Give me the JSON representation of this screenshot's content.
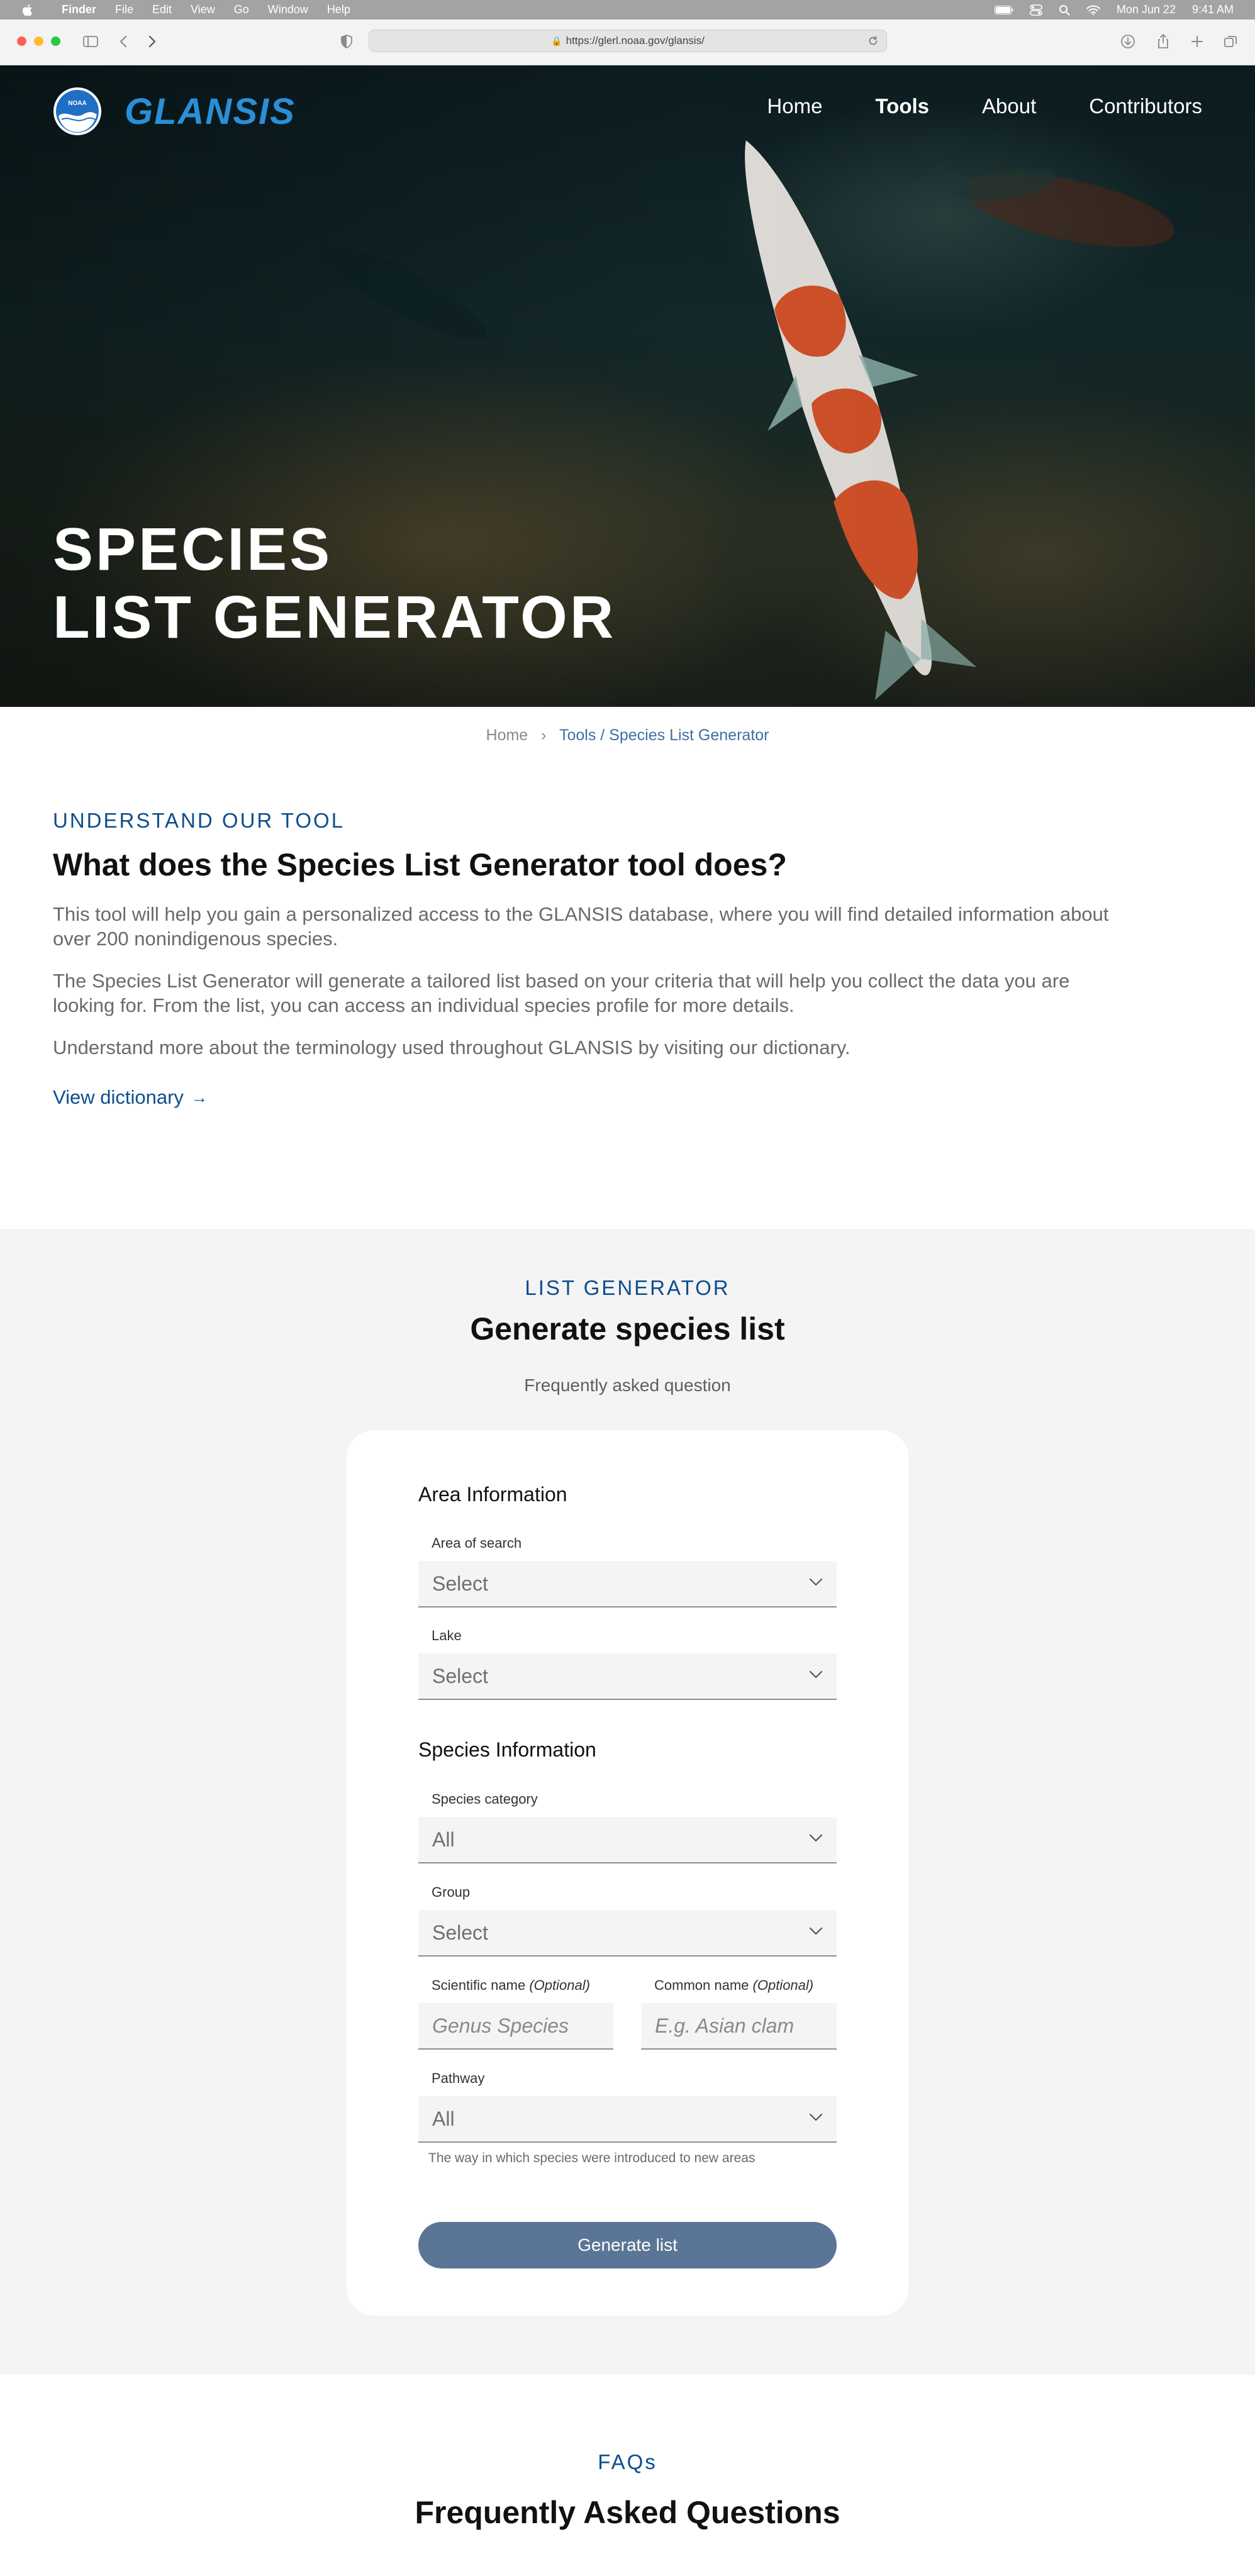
{
  "menubar": {
    "app_name": "Finder",
    "items": [
      "File",
      "Edit",
      "View",
      "Go",
      "Window",
      "Help"
    ],
    "date": "Mon Jun 22",
    "time": "9:41 AM"
  },
  "browser": {
    "url": "https://glerl.noaa.gov/glansis/"
  },
  "header": {
    "logo_badge_text": "NOAA",
    "logo_wordmark": "GLANSIS",
    "nav": [
      "Home",
      "Tools",
      "About",
      "Contributors"
    ],
    "active_nav": "Tools"
  },
  "hero": {
    "title_line1": "SPECIES",
    "title_line2": "LIST GENERATOR"
  },
  "breadcrumb": {
    "home": "Home",
    "current": "Tools / Species List Generator"
  },
  "understand": {
    "eyebrow": "UNDERSTAND OUR TOOL",
    "heading": "What does the Species List Generator tool does?",
    "p1": "This tool will help you gain a personalized access to the GLANSIS database, where you will find detailed information about over 200 nonindigenous species.",
    "p2": "The Species List Generator will generate a tailored list based on your criteria that will help you collect the data you are looking for. From the list, you can access an individual species profile for more details.",
    "p3": "Understand more about the terminology used throughout GLANSIS by visiting our dictionary.",
    "link": "View dictionary"
  },
  "generator": {
    "eyebrow": "LIST GENERATOR",
    "heading": "Generate species list",
    "subtext": "Frequently asked question",
    "area_title": "Area Information",
    "area_label": "Area of search",
    "area_value": "Select",
    "lake_label": "Lake",
    "lake_value": "Select",
    "species_title": "Species Information",
    "category_label": "Species category",
    "category_value": "All",
    "group_label": "Group",
    "group_value": "Select",
    "sci_label": "Scientific name",
    "sci_optional": "(Optional)",
    "sci_placeholder": "Genus Species",
    "common_label": "Common name",
    "common_optional": "(Optional)",
    "common_placeholder": "E.g. Asian clam",
    "pathway_label": "Pathway",
    "pathway_value": "All",
    "pathway_helper": "The way in which species were introduced to new areas",
    "button": "Generate list"
  },
  "faq": {
    "eyebrow": "FAQs",
    "heading": "Frequently Asked Questions"
  }
}
